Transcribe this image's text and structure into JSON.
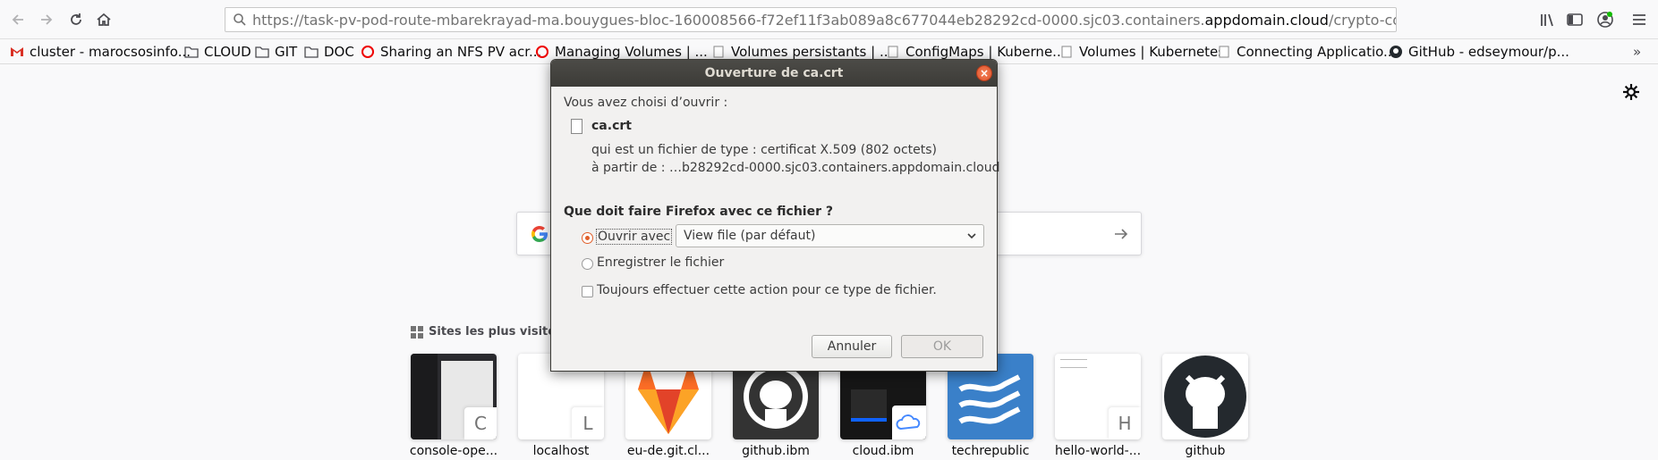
{
  "browser": {
    "url_prefix": "https://task-pv-pod-route-mbarekrayad-ma.bouygues-bloc-160008566-f72ef11f3ab089a8c677044eb28292cd-0000.sjc03.containers.",
    "url_domain": "appdomain.cloud",
    "url_suffix": "/crypto-config/ordererOrganizations/b"
  },
  "bookmarks": [
    {
      "label": "cluster - marocsosinfo...",
      "icon": "gmail-icon"
    },
    {
      "label": "CLOUD",
      "icon": "folder-icon"
    },
    {
      "label": "GIT",
      "icon": "folder-icon"
    },
    {
      "label": "DOC",
      "icon": "folder-icon"
    },
    {
      "label": "Sharing an NFS PV acr...",
      "icon": "redhat-icon"
    },
    {
      "label": "Managing Volumes | ...",
      "icon": "redhat-icon"
    },
    {
      "label": "Volumes persistants | ...",
      "icon": "page-icon"
    },
    {
      "label": "ConfigMaps | Kuberne...",
      "icon": "page-icon"
    },
    {
      "label": "Volumes | Kubernetes",
      "icon": "page-icon"
    },
    {
      "label": "Connecting Applicatio...",
      "icon": "page-icon"
    },
    {
      "label": "GitHub - edseymour/p...",
      "icon": "github-icon"
    }
  ],
  "newtab": {
    "topsites_label": "Sites les plus visités",
    "tiles": [
      {
        "label": "console-ope...",
        "letter": "C"
      },
      {
        "label": "localhost",
        "letter": "L"
      },
      {
        "label": "eu-de.git.cl...",
        "letter": ""
      },
      {
        "label": "github.ibm",
        "letter": ""
      },
      {
        "label": "cloud.ibm",
        "letter": ""
      },
      {
        "label": "techrepublic",
        "letter": ""
      },
      {
        "label": "hello-world-...",
        "letter": "H"
      },
      {
        "label": "github",
        "letter": ""
      }
    ]
  },
  "dialog": {
    "title": "Ouverture de ca.crt",
    "chosen_label": "Vous avez choisi d’ouvrir :",
    "filename": "ca.crt",
    "type_line": "qui est un fichier de type : certificat X.509 (802 octets)",
    "source_line": "à partir de : …b28292cd-0000.sjc03.containers.appdomain.cloud",
    "question": "Que doit faire Firefox avec ce fichier ?",
    "open_with_label": "Ouvrir avec",
    "open_with_value": "View file (par défaut)",
    "save_label": "Enregistrer le fichier",
    "always_label": "Toujours effectuer cette action pour ce type de fichier.",
    "cancel_label": "Annuler",
    "ok_label": "OK"
  }
}
